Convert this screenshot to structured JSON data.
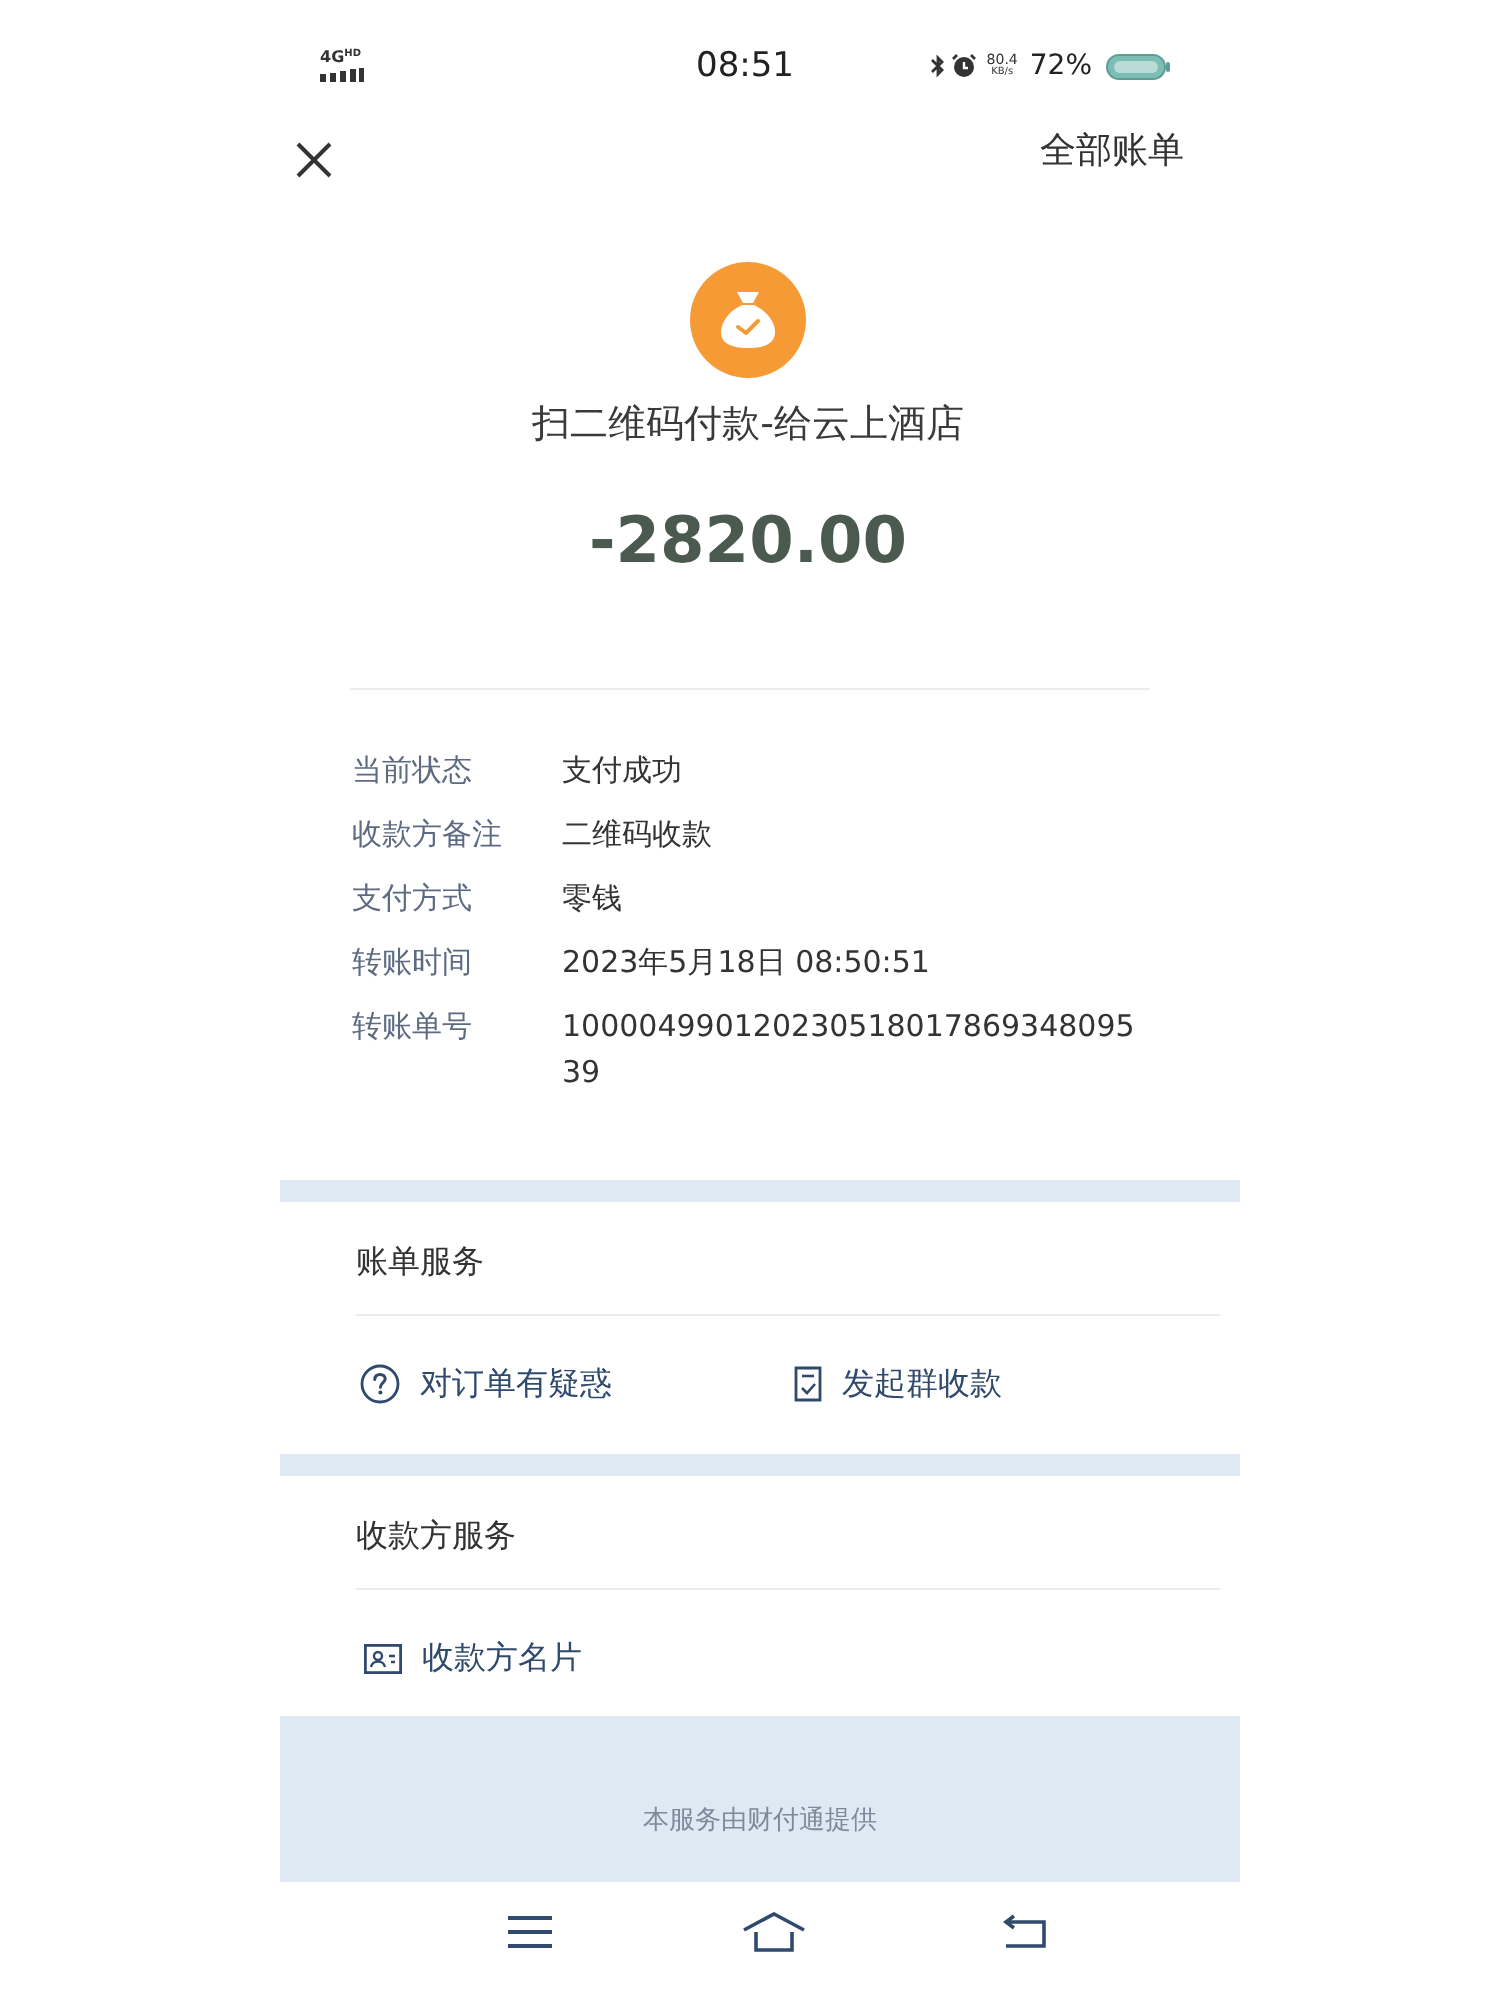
{
  "status_bar": {
    "network": "4G",
    "network_badge": "HD",
    "time": "08:51",
    "speed_value": "80.4",
    "speed_unit": "KB/s",
    "battery": "72%"
  },
  "header": {
    "all_bills_link": "全部账单"
  },
  "payment": {
    "title": "扫二维码付款-给云上酒店",
    "amount": "-2820.00"
  },
  "details": [
    {
      "label": "当前状态",
      "value": "支付成功"
    },
    {
      "label": "收款方备注",
      "value": "二维码收款"
    },
    {
      "label": "支付方式",
      "value": "零钱"
    },
    {
      "label": "转账时间",
      "value": "2023年5月18日 08:50:51"
    },
    {
      "label": "转账单号",
      "value": "10000499012023051801786934809539"
    }
  ],
  "bill_services": {
    "title": "账单服务",
    "actions": [
      {
        "kind": "question",
        "label": "对订单有疑惑"
      },
      {
        "kind": "group",
        "label": "发起群收款"
      }
    ]
  },
  "payee_services": {
    "title": "收款方服务",
    "actions": [
      {
        "kind": "card",
        "label": "收款方名片"
      }
    ]
  },
  "footer": {
    "text": "本服务由财付通提供"
  }
}
